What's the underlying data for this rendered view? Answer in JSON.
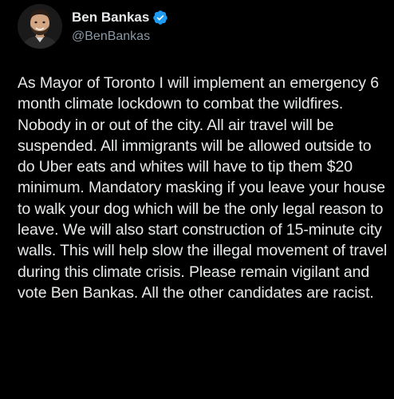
{
  "author": {
    "display_name": "Ben Bankas",
    "handle": "@BenBankas",
    "verified_icon": "verified-badge-icon",
    "avatar_icon": "avatar-photo"
  },
  "tweet": {
    "text": "As Mayor of Toronto I will implement an emergency 6 month climate lockdown to combat the wildfires. Nobody in or out of the city. All air travel will be suspended. All immigrants will be allowed outside to do Uber eats and whites will have to tip them $20 minimum. Mandatory masking if you leave your house to walk your dog which will be the only legal reason to leave. We will also start construction of 15-minute city walls. This will help slow the illegal movement of travel during this climate crisis. Please remain vigilant and vote Ben Bankas. All the other candidates are racist."
  },
  "colors": {
    "background": "#000000",
    "text": "#e7e9ea",
    "secondary_text": "#8b98a5",
    "verified": "#1d9bf0"
  }
}
